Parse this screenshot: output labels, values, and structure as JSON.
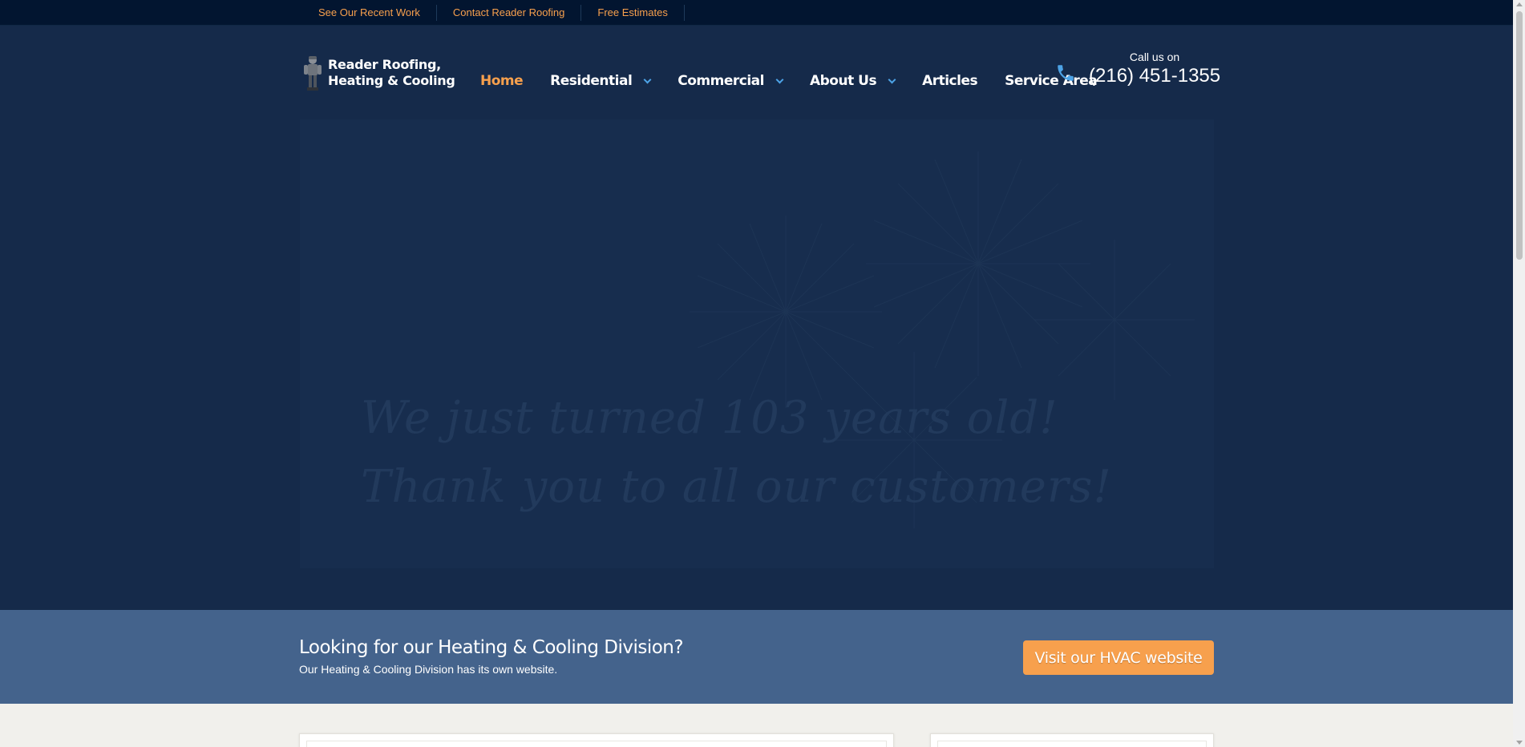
{
  "topbar": {
    "links": [
      "See Our Recent Work",
      "Contact Reader Roofing",
      "Free Estimates"
    ]
  },
  "logo": {
    "line1": "Reader Roofing,",
    "line2": "Heating & Cooling",
    "icon": "roofer-figure-icon"
  },
  "nav": {
    "items": [
      {
        "label": "Home",
        "active": true,
        "dropdown": false
      },
      {
        "label": "Residential",
        "active": false,
        "dropdown": true
      },
      {
        "label": "Commercial",
        "active": false,
        "dropdown": true
      },
      {
        "label": "About Us",
        "active": false,
        "dropdown": true
      },
      {
        "label": "Articles",
        "active": false,
        "dropdown": false
      },
      {
        "label": "Service Area",
        "active": false,
        "dropdown": false
      }
    ]
  },
  "call": {
    "label": "Call us on",
    "number": "(216) 451-1355",
    "icon": "phone-icon"
  },
  "hero": {
    "line1": "We just turned 103 years old!",
    "line2": "Thank you to all our customers!"
  },
  "hvac": {
    "title": "Looking for our Heating & Cooling Division?",
    "subtitle": "Our Heating & Cooling Division has its own website.",
    "button": "Visit our HVAC website"
  },
  "colors": {
    "accent": "#f7a04d",
    "header_bg": "#152a4a",
    "topbar_bg": "#021530",
    "band_bg": "#44638c",
    "chevron": "#4da3e6"
  }
}
